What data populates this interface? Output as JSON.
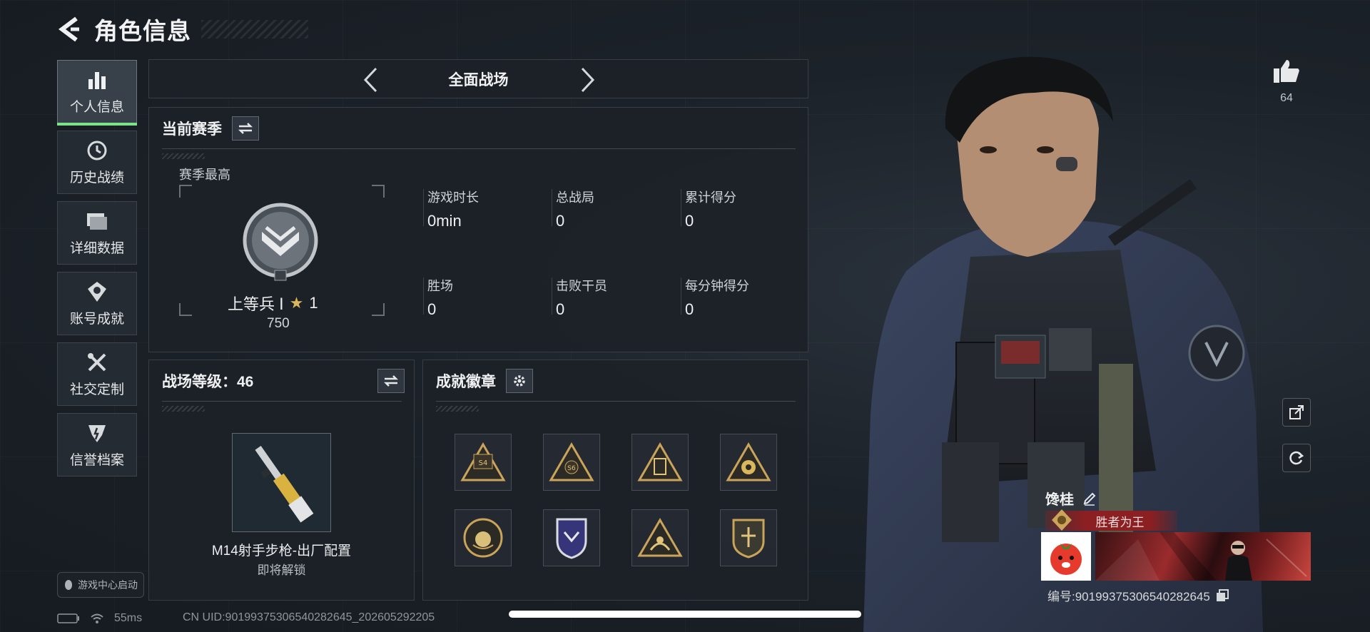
{
  "header": {
    "title": "角色信息"
  },
  "sidebar": {
    "items": [
      {
        "label": "个人信息",
        "icon": "bar-chart-icon",
        "active": true
      },
      {
        "label": "历史战绩",
        "icon": "clock-history-icon",
        "active": false
      },
      {
        "label": "详细数据",
        "icon": "folder-icon",
        "active": false
      },
      {
        "label": "账号成就",
        "icon": "medal-icon",
        "active": false
      },
      {
        "label": "社交定制",
        "icon": "tools-icon",
        "active": false
      },
      {
        "label": "信誉档案",
        "icon": "credit-shield-icon",
        "active": false
      }
    ],
    "launch_label": "游戏中心启动"
  },
  "mode_bar": {
    "title": "全面战场"
  },
  "season": {
    "heading": "当前赛季",
    "best_label": "赛季最高",
    "rank_name": "上等兵 Ⅰ",
    "rank_stars": "1",
    "rank_score": "750",
    "stats": [
      {
        "label": "游戏时长",
        "value": "0min"
      },
      {
        "label": "总战局",
        "value": "0"
      },
      {
        "label": "累计得分",
        "value": "0"
      },
      {
        "label": "胜场",
        "value": "0"
      },
      {
        "label": "击败干员",
        "value": "0"
      },
      {
        "label": "每分钟得分",
        "value": "0"
      }
    ]
  },
  "battle_level": {
    "heading": "战场等级：46",
    "weapon_name": "M14射手步枪-出厂配置",
    "weapon_status": "即将解锁"
  },
  "badges": {
    "heading": "成就徽章",
    "items": [
      {
        "icon": "s4-triangle-badge-icon",
        "text": "S4"
      },
      {
        "icon": "s6-triangle-badge-icon",
        "text": "S6"
      },
      {
        "icon": "tower-triangle-badge-icon"
      },
      {
        "icon": "flower-triangle-badge-icon"
      },
      {
        "icon": "sphere-circle-badge-icon"
      },
      {
        "icon": "purple-shield-badge-icon"
      },
      {
        "icon": "laurel-triangle-badge-icon"
      },
      {
        "icon": "emblem-shield-badge-icon"
      }
    ]
  },
  "profile": {
    "likes": "64",
    "player_name": "馋桂",
    "player_title": "胜者为王",
    "uid_label": "编号:9019937530654028264​5"
  },
  "footer": {
    "ping": "55ms",
    "uid_line": "CN UID:9019937530654028264​5_202605292205"
  },
  "colors": {
    "accent_green": "#7be38a",
    "title_red": "#8b1f22",
    "gold": "#c9a45a"
  }
}
